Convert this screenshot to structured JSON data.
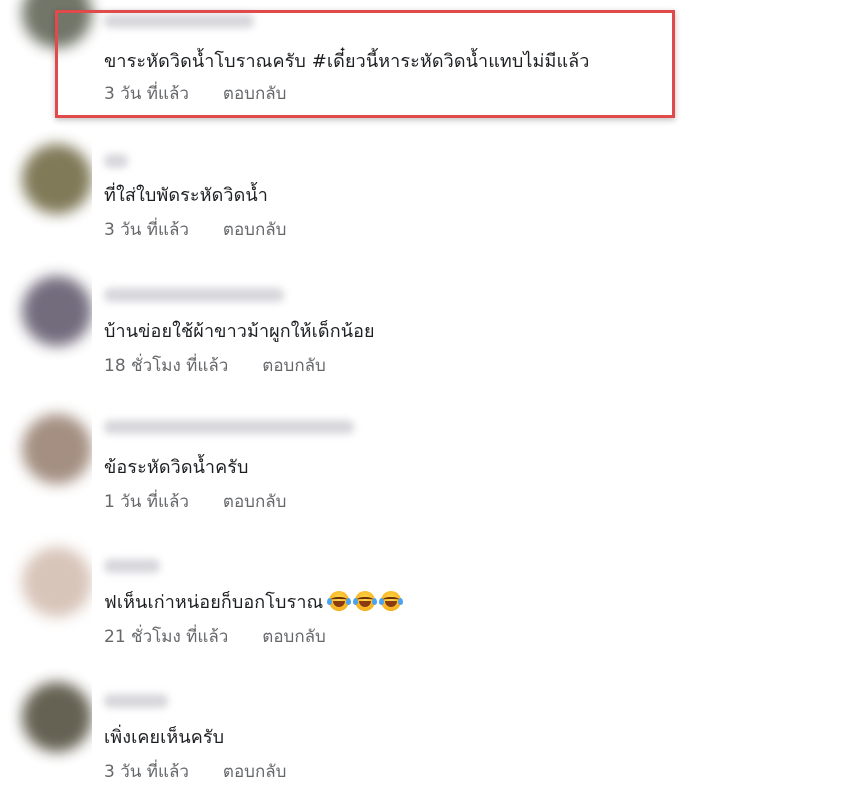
{
  "comments": [
    {
      "text": "ขาระหัดวิดน้ำโบราณครับ #เดี๋ยวนี้หาระหัดวิดน้ำแทบไม่มีแล้ว",
      "time": "3 วัน ที่แล้ว",
      "reply": "ตอบกลับ",
      "avatar_color": "#6b6f61",
      "highlighted": true
    },
    {
      "text": "ที่ใส่ใบพัดระหัดวิดน้ำ",
      "time": "3 วัน ที่แล้ว",
      "reply": "ตอบกลับ",
      "avatar_color": "#7a7350"
    },
    {
      "text": "บ้านข่อยใช้ผ้าขาวม้าผูกให้เด็กน้อย",
      "time": "18 ชั่วโมง ที่แล้ว",
      "reply": "ตอบกลับ",
      "avatar_color": "#6c6577"
    },
    {
      "text": "ข้อระหัดวิดน้ำครับ",
      "time": "1 วัน ที่แล้ว",
      "reply": "ตอบกลับ",
      "avatar_color": "#a08a7c"
    },
    {
      "text": "ฟเห็นเก่าหน่อยก็บอกโบราณ",
      "emoji_count": 3,
      "emoji_name": "laughing-tears-emoji",
      "time": "21 ชั่วโมง ที่แล้ว",
      "reply": "ตอบกลับ",
      "avatar_color": "#d6c2b6"
    },
    {
      "text": "เพิ่งเคยเห็นครับ",
      "time": "3 วัน ที่แล้ว",
      "reply": "ตอบกลับ",
      "avatar_color": "#5e5a4a"
    }
  ],
  "colors": {
    "text": "#1c1e21",
    "meta": "#65676b",
    "highlight_border": "#e04a4a"
  }
}
